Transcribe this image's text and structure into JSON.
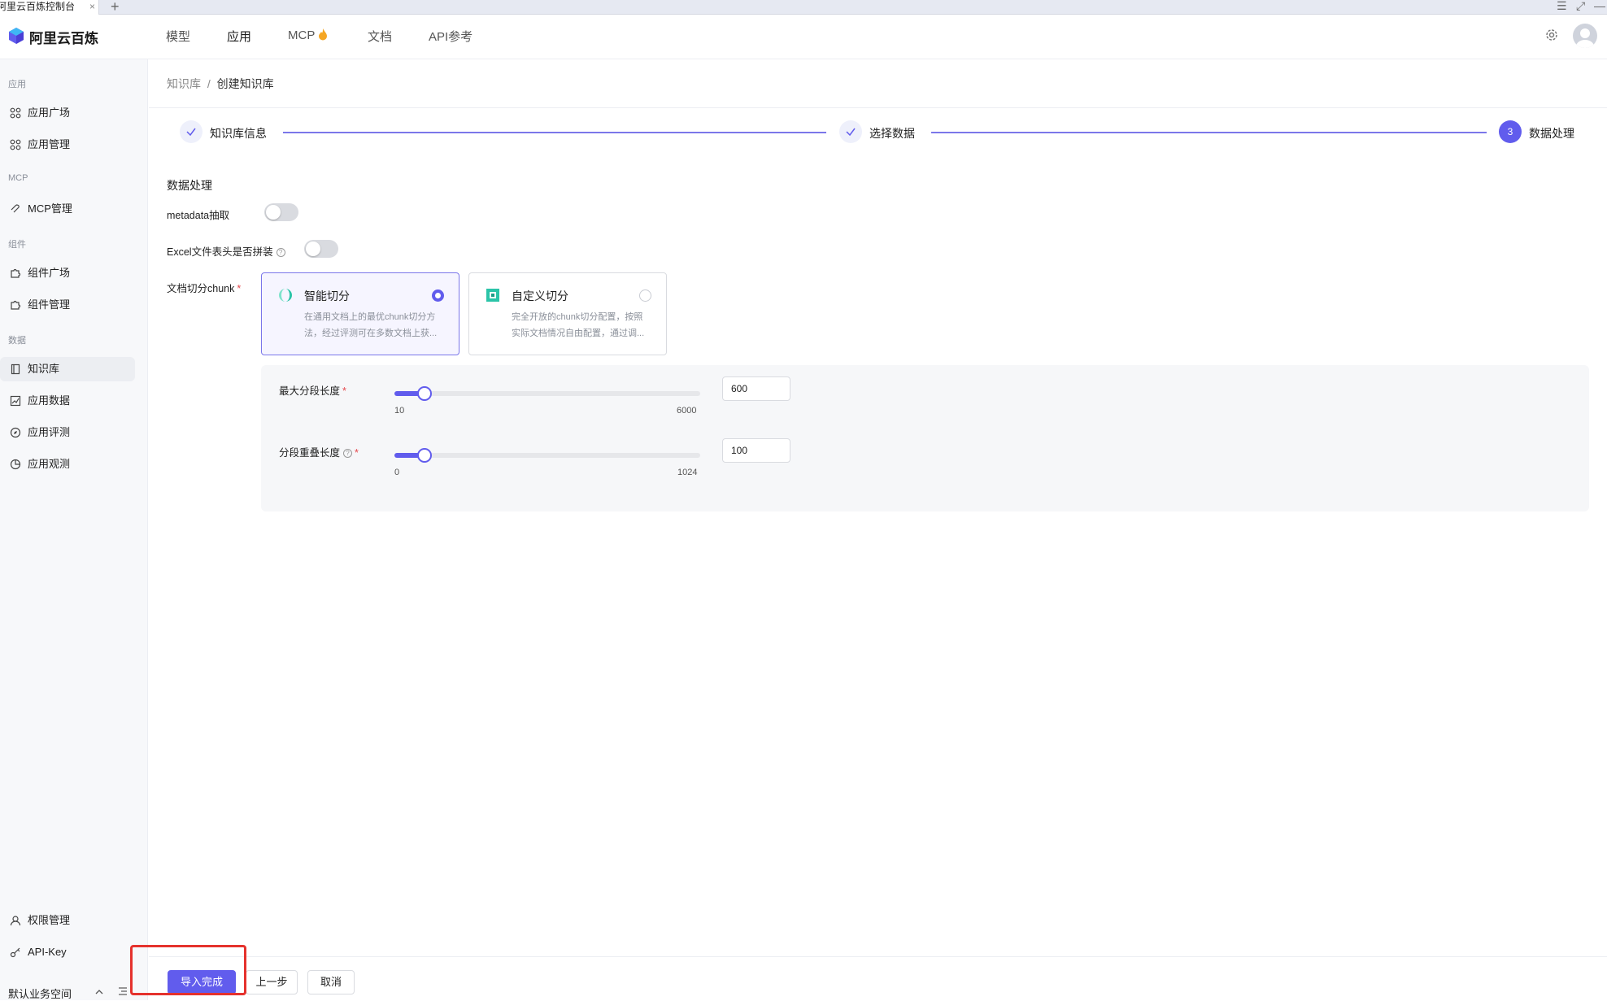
{
  "browser": {
    "tab_title": "阿里云百炼控制台",
    "tab_close": "×",
    "new_tab": "+"
  },
  "topnav": {
    "brand": "阿里云百炼",
    "items": [
      "模型",
      "应用",
      "MCP",
      "文档",
      "API参考"
    ],
    "active": "应用"
  },
  "sidebar": {
    "group_app": "应用",
    "app_square": "应用广场",
    "app_manage": "应用管理",
    "group_mcp": "MCP",
    "mcp_manage": "MCP管理",
    "group_component": "组件",
    "component_square": "组件广场",
    "component_manage": "组件管理",
    "group_data": "数据",
    "knowledge_base": "知识库",
    "app_data": "应用数据",
    "app_eval": "应用评测",
    "app_observe": "应用观测",
    "permission": "权限管理",
    "api_key": "API-Key",
    "workspace": "默认业务空间"
  },
  "breadcrumb": {
    "parent": "知识库",
    "sep": "/",
    "current": "创建知识库"
  },
  "steps": [
    {
      "label": "知识库信息",
      "status": "done"
    },
    {
      "label": "选择数据",
      "status": "done"
    },
    {
      "label": "数据处理",
      "status": "current",
      "number": "3"
    }
  ],
  "form": {
    "section_title": "数据处理",
    "metadata_label": "metadata抽取",
    "metadata_on": false,
    "excel_label": "Excel文件表头是否拼装",
    "excel_on": false,
    "chunk_label": "文档切分chunk",
    "required_mark": "*",
    "cards": [
      {
        "title": "智能切分",
        "desc1": "在通用文档上的最优chunk切分方",
        "desc2": "法，经过评测可在多数文档上获...",
        "selected": true
      },
      {
        "title": "自定义切分",
        "desc1": "完全开放的chunk切分配置，按照",
        "desc2": "实际文档情况自由配置，通过调...",
        "selected": false
      }
    ],
    "max_len": {
      "label": "最大分段长度",
      "min": "10",
      "max": "6000",
      "value": "600",
      "min_value": 10,
      "max_value": 6000,
      "current": 600
    },
    "overlap": {
      "label": "分段重叠长度",
      "min": "0",
      "max": "1024",
      "value": "100",
      "min_value": 0,
      "max_value": 1024,
      "current": 100
    }
  },
  "footer": {
    "submit": "导入完成",
    "prev": "上一步",
    "cancel": "取消"
  },
  "colors": {
    "accent": "#615ced",
    "highlight": "#e5322d"
  }
}
